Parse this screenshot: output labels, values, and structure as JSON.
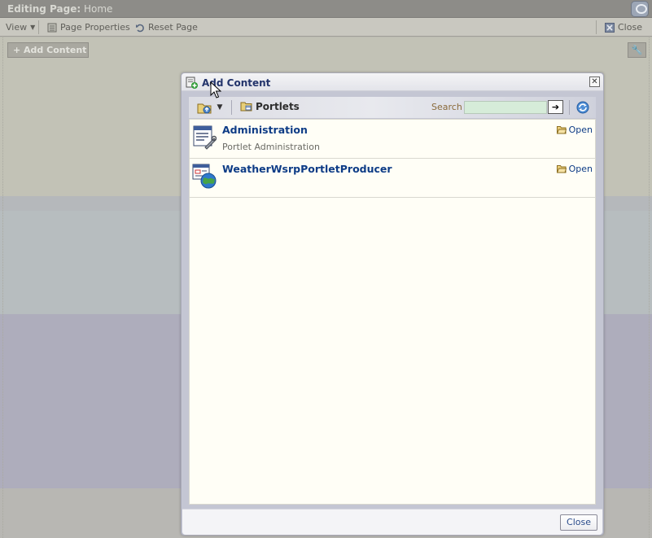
{
  "page": {
    "title_prefix": "Editing Page:",
    "title_page": "Home",
    "logo_icon": "oracle-logo-icon"
  },
  "toolbar": {
    "view": "View",
    "page_properties": "Page Properties",
    "reset_page": "Reset Page",
    "close": "Close"
  },
  "canvas": {
    "add_content": "+ Add Content",
    "wrench_icon": "wrench-icon"
  },
  "dialog": {
    "title": "Add Content",
    "close_glyph": "✕",
    "crumb": "Portlets",
    "search": {
      "label": "Search",
      "value": "",
      "go_glyph": "➔"
    },
    "items": [
      {
        "name": "Administration",
        "description": "Portlet Administration",
        "action": "Open",
        "icon": "admin-portlet-icon"
      },
      {
        "name": "WeatherWsrpPortletProducer",
        "description": "",
        "action": "Open",
        "icon": "wsrp-producer-icon"
      }
    ],
    "footer_close": "Close"
  },
  "colors": {
    "title_text": "#23346b",
    "link_text": "#0e3c86",
    "search_field": "#d6ecd9",
    "panel_bg": "#fffef6"
  }
}
